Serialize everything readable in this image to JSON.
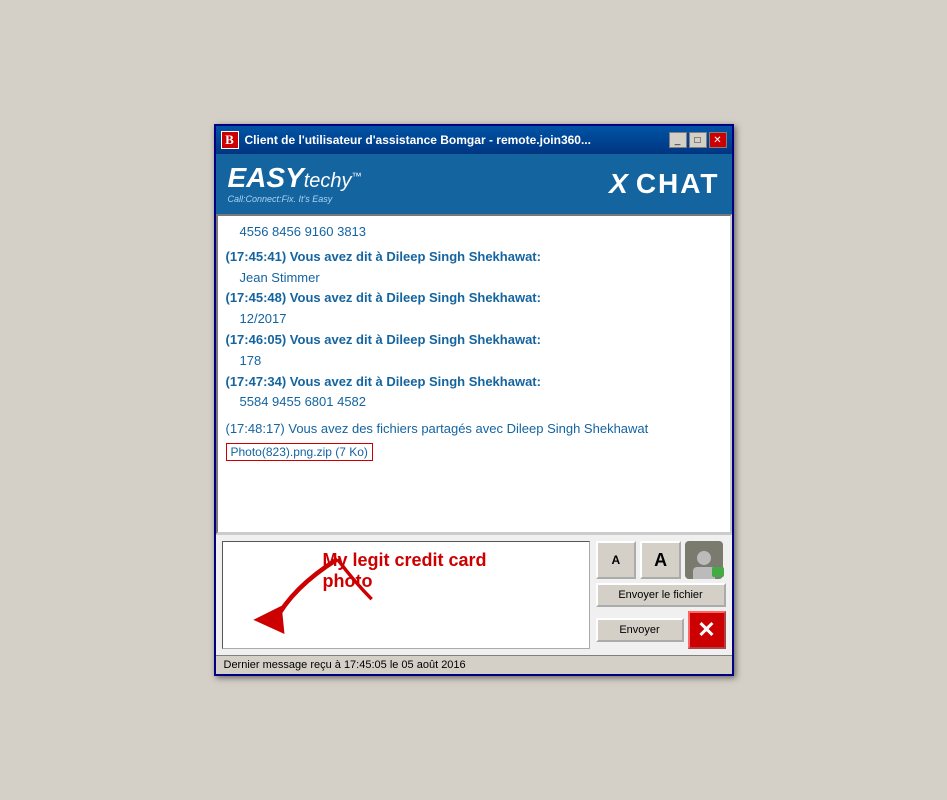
{
  "title_bar": {
    "icon_label": "B",
    "title": "Client de l'utilisateur d'assistance Bomgar - remote.join360...",
    "minimize_label": "_",
    "maximize_label": "□",
    "close_label": "✕"
  },
  "header": {
    "logo_easy": "EASY",
    "logo_techy": "techy",
    "logo_tm": "™",
    "logo_tagline": "Call:Connect:Fix. It's Easy",
    "x_label": "X",
    "chat_label": "CHAT"
  },
  "chat_messages": [
    {
      "id": 1,
      "type": "number",
      "text": "4556 8456 9160 3813"
    },
    {
      "id": 2,
      "type": "sender",
      "text": "(17:45:41) Vous avez dit à Dileep Singh Shekhawat:"
    },
    {
      "id": 3,
      "type": "message",
      "text": "Jean Stimmer"
    },
    {
      "id": 4,
      "type": "sender",
      "text": "(17:45:48) Vous avez dit à Dileep Singh Shekhawat:"
    },
    {
      "id": 5,
      "type": "message",
      "text": "12/2017"
    },
    {
      "id": 6,
      "type": "sender",
      "text": "(17:46:05) Vous avez dit à Dileep Singh Shekhawat:"
    },
    {
      "id": 7,
      "type": "message",
      "text": "178"
    },
    {
      "id": 8,
      "type": "sender",
      "text": "(17:47:34) Vous avez dit à Dileep Singh Shekhawat:"
    },
    {
      "id": 9,
      "type": "message",
      "text": "5584 9455 6801 4582"
    },
    {
      "id": 10,
      "type": "notification",
      "text": "(17:48:17) Vous avez des fichiers partagés avec Dileep Singh Shekhawat"
    },
    {
      "id": 11,
      "type": "file",
      "text": "Photo(823).png.zip (7 Ko)"
    }
  ],
  "input_area": {
    "placeholder": "",
    "current_value": "|",
    "annotation_text": "My legit credit card photo",
    "font_small_label": "A",
    "font_large_label": "A",
    "send_file_label": "Envoyer le fichier",
    "send_label": "Envoyer",
    "close_icon": "✕"
  },
  "status_bar": {
    "text": "Dernier message reçu à 17:45:05 le 05 août 2016"
  }
}
